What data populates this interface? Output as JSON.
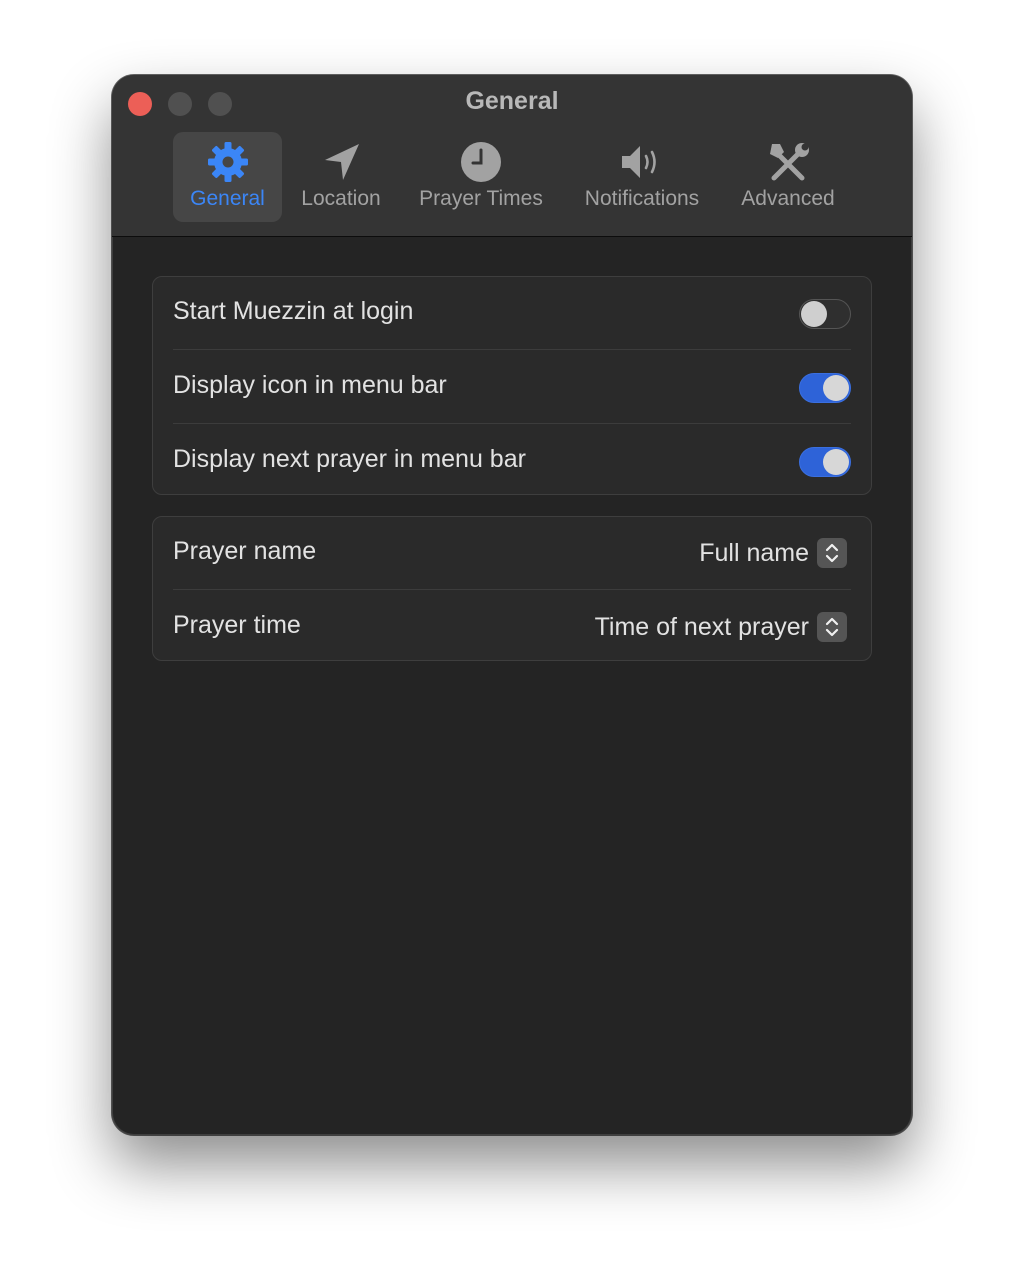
{
  "window": {
    "title": "General"
  },
  "toolbar": {
    "tabs": [
      {
        "label": "General",
        "icon": "gear-icon",
        "selected": true
      },
      {
        "label": "Location",
        "icon": "location-arrow-icon",
        "selected": false
      },
      {
        "label": "Prayer Times",
        "icon": "clock-icon",
        "selected": false
      },
      {
        "label": "Notifications",
        "icon": "speaker-icon",
        "selected": false
      },
      {
        "label": "Advanced",
        "icon": "tools-icon",
        "selected": false
      }
    ]
  },
  "startup_group": {
    "rows": [
      {
        "label": "Start Muezzin at login",
        "toggle": false
      },
      {
        "label": "Display icon in menu bar",
        "toggle": true
      },
      {
        "label": "Display next prayer in menu bar",
        "toggle": true
      }
    ]
  },
  "display_group": {
    "rows": [
      {
        "label": "Prayer name",
        "value": "Full name"
      },
      {
        "label": "Prayer time",
        "value": "Time of next prayer"
      }
    ]
  },
  "colors": {
    "accent": "#3b86f7",
    "toggle_on": "#2e63d8",
    "close_button": "#ec5f57",
    "window_bg": "#242424",
    "titlebar_bg": "#343434"
  }
}
